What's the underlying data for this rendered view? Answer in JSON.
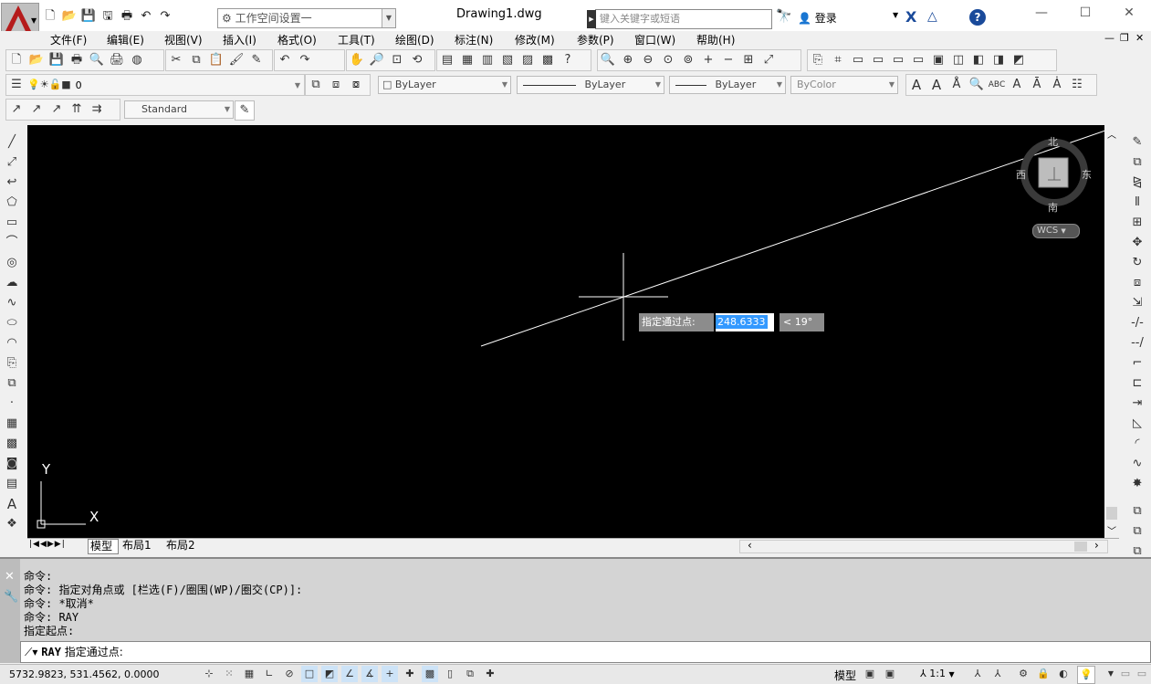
{
  "titlebar": {
    "document": "Drawing1.dwg",
    "workspace": "工作空间设置一",
    "search_placeholder": "键入关键字或短语",
    "login": "登录"
  },
  "menu": [
    "文件(F)",
    "编辑(E)",
    "视图(V)",
    "插入(I)",
    "格式(O)",
    "工具(T)",
    "绘图(D)",
    "标注(N)",
    "修改(M)",
    "参数(P)",
    "窗口(W)",
    "帮助(H)"
  ],
  "layer": {
    "current": "0"
  },
  "properties": {
    "color": "ByLayer",
    "linetype": "ByLayer",
    "lineweight": "ByLayer",
    "plotstyle": "ByColor"
  },
  "dimstyle": "Standard",
  "viewcube": {
    "north": "北",
    "south": "南",
    "east": "东",
    "west": "西",
    "ucs": "WCS"
  },
  "tooltip": {
    "prompt": "指定通过点:",
    "distance": "248.6333",
    "angle": "< 19°"
  },
  "ucs_icon": {
    "x": "X",
    "y": "Y"
  },
  "layout_tabs": [
    "模型",
    "布局1",
    "布局2"
  ],
  "command_history": [
    "命令:",
    "命令: 指定对角点或 [栏选(F)/圈围(WP)/圈交(CP)]:",
    "命令: *取消*",
    "命令: RAY",
    "指定起点:"
  ],
  "command_line": {
    "cmd": "RAY",
    "prompt": "指定通过点:"
  },
  "status": {
    "coords": "5732.9823, 531.4562, 0.0000",
    "model": "模型",
    "scale": "1:1"
  }
}
